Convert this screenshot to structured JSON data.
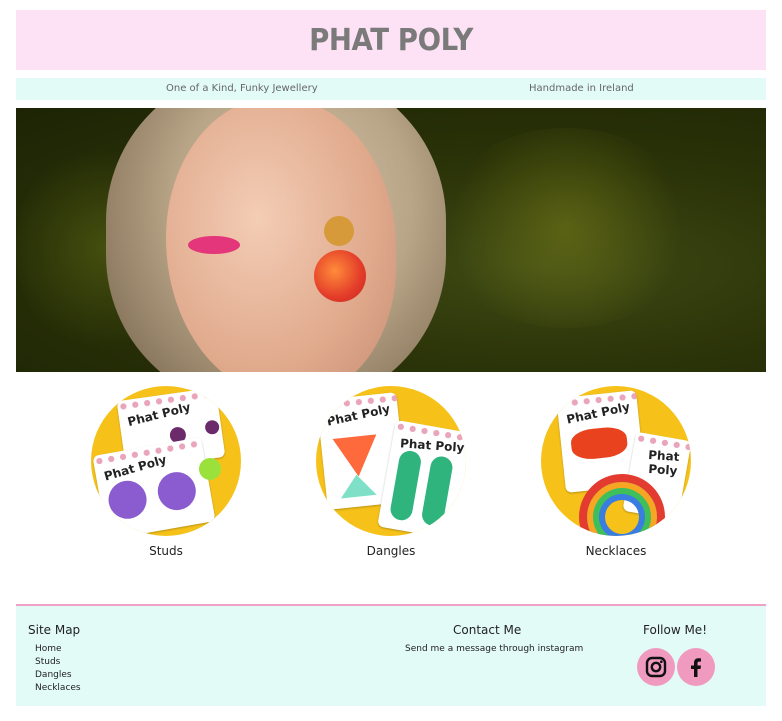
{
  "header": {
    "logo": "PHAT POLY"
  },
  "taglines": {
    "left": "One of a Kind, Funky Jewellery",
    "right": "Handmade in Ireland"
  },
  "categories": [
    {
      "label": "Studs"
    },
    {
      "label": "Dangles"
    },
    {
      "label": "Necklaces"
    }
  ],
  "product_card_brand": "Phat Poly",
  "footer": {
    "sitemap": {
      "title": "Site Map",
      "links": [
        "Home",
        "Studs",
        "Dangles",
        "Necklaces"
      ]
    },
    "contact": {
      "title": "Contact Me",
      "text": "Send me a message through instagram"
    },
    "follow": {
      "title": "Follow Me!",
      "icons": [
        "instagram-icon",
        "facebook-icon"
      ]
    }
  },
  "colors": {
    "header_bg": "#fde1f4",
    "tagline_bg": "#e2fbf6",
    "footer_bg": "#e2fbf6",
    "divider": "#f0a0c4",
    "social_bg": "#f09ac0",
    "logo": "#7a7a7a"
  }
}
